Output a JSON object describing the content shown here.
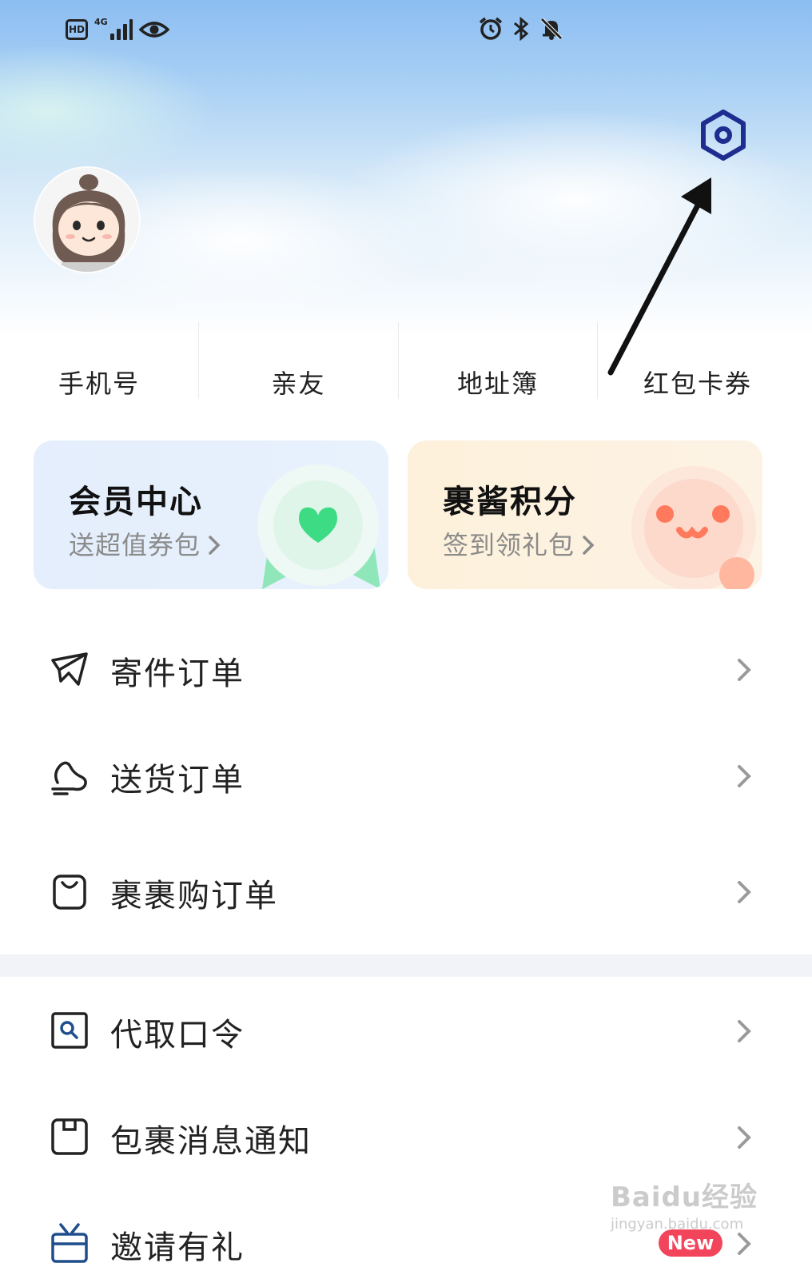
{
  "status_bar": {
    "left_badge": "HD",
    "network": "4G",
    "network_sub": "4G",
    "icons_left": [
      "hd-icon",
      "signal-icon",
      "eye-icon"
    ],
    "icons_right": [
      "alarm-icon",
      "bluetooth-icon",
      "mute-bell-icon"
    ]
  },
  "header": {
    "settings_icon": "settings-hexagon-icon",
    "avatar_icon": "avatar-girl-icon"
  },
  "quick_links": [
    {
      "label": "手机号"
    },
    {
      "label": "亲友"
    },
    {
      "label": "地址簿"
    },
    {
      "label": "红包卡券"
    }
  ],
  "cards": {
    "member": {
      "title": "会员中心",
      "subtitle": "送超值券包",
      "accent": "#3ddc84"
    },
    "points": {
      "title": "裹酱积分",
      "subtitle": "签到领礼包",
      "accent": "#ff7a5c"
    }
  },
  "menu": {
    "group1": [
      {
        "label": "寄件订单",
        "icon": "send-plane-icon"
      },
      {
        "label": "送货订单",
        "icon": "delivery-hand-icon"
      },
      {
        "label": "裹裹购订单",
        "icon": "shopping-bag-icon"
      }
    ],
    "group2": [
      {
        "label": "代取口令",
        "icon": "pickup-code-icon"
      },
      {
        "label": "包裹消息通知",
        "icon": "package-notice-icon"
      },
      {
        "label": "邀请有礼",
        "icon": "gift-icon",
        "badge": "New"
      }
    ]
  },
  "colors": {
    "settings_icon": "#1e2d8f",
    "new_badge": "#f2455c",
    "divider_band": "#f1f3f8"
  },
  "watermark": {
    "main": "Baidu经验",
    "sub": "jingyan.baidu.com"
  }
}
